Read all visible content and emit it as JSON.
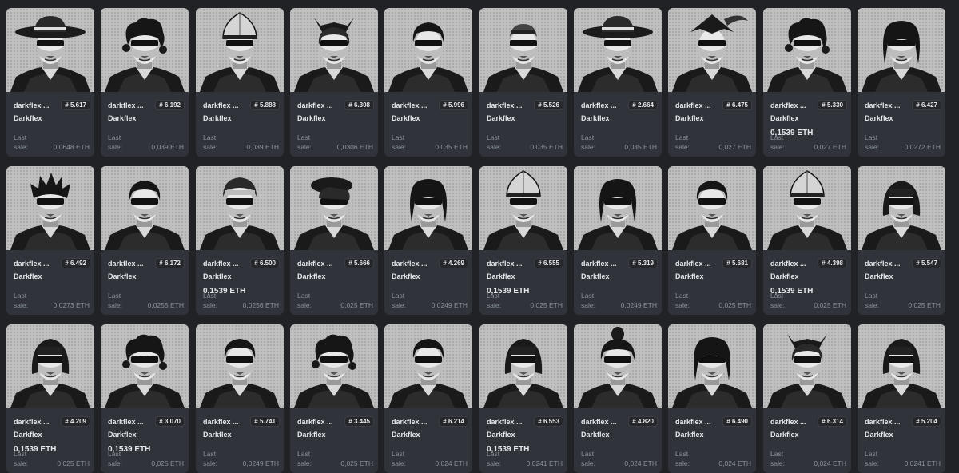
{
  "collection_name": "Darkflex",
  "last_sale_label": "Last sale:",
  "currency": "ETH",
  "rows": [
    [
      {
        "name": "darkflex ...",
        "rank": "# 5.617",
        "price": "",
        "last_sale": "0,0648 ETH",
        "head": "hat"
      },
      {
        "name": "darkflex ...",
        "rank": "# 6.192",
        "price": "",
        "last_sale": "0,039 ETH",
        "head": "curly"
      },
      {
        "name": "darkflex ...",
        "rank": "# 5.888",
        "price": "",
        "last_sale": "0,039 ETH",
        "head": "helmet"
      },
      {
        "name": "darkflex ...",
        "rank": "# 6.308",
        "price": "",
        "last_sale": "0,0306 ETH",
        "head": "horned"
      },
      {
        "name": "darkflex ...",
        "rank": "# 5.996",
        "price": "",
        "last_sale": "0,035 ETH",
        "head": "short"
      },
      {
        "name": "darkflex ...",
        "rank": "# 5.526",
        "price": "",
        "last_sale": "0,035 ETH",
        "head": "bald"
      },
      {
        "name": "darkflex ...",
        "rank": "# 2.664",
        "price": "",
        "last_sale": "0,035 ETH",
        "head": "hat"
      },
      {
        "name": "darkflex ...",
        "rank": "# 6.475",
        "price": "",
        "last_sale": "0,027 ETH",
        "head": "tricorn"
      },
      {
        "name": "darkflex ...",
        "rank": "# 5.330",
        "price": "0,1539 ETH",
        "last_sale": "0,027 ETH",
        "head": "curly"
      },
      {
        "name": "darkflex ...",
        "rank": "# 6.427",
        "price": "",
        "last_sale": "0,0272 ETH",
        "head": "long"
      }
    ],
    [
      {
        "name": "darkflex ...",
        "rank": "# 6.492",
        "price": "",
        "last_sale": "0,0273 ETH",
        "head": "spiky"
      },
      {
        "name": "darkflex ...",
        "rank": "# 6.172",
        "price": "",
        "last_sale": "0,0255 ETH",
        "head": "short"
      },
      {
        "name": "darkflex ...",
        "rank": "# 6.500",
        "price": "0,1539 ETH",
        "last_sale": "0,0256 ETH",
        "head": "cap"
      },
      {
        "name": "darkflex ...",
        "rank": "# 5.666",
        "price": "",
        "last_sale": "0,025 ETH",
        "head": "beret"
      },
      {
        "name": "darkflex ...",
        "rank": "# 4.269",
        "price": "",
        "last_sale": "0,0249 ETH",
        "head": "long"
      },
      {
        "name": "darkflex ...",
        "rank": "# 6.555",
        "price": "0,1539 ETH",
        "last_sale": "0,025 ETH",
        "head": "helmet"
      },
      {
        "name": "darkflex ...",
        "rank": "# 5.319",
        "price": "",
        "last_sale": "0,0249 ETH",
        "head": "long"
      },
      {
        "name": "darkflex ...",
        "rank": "# 5.681",
        "price": "",
        "last_sale": "0,025 ETH",
        "head": "short"
      },
      {
        "name": "darkflex ...",
        "rank": "# 4.398",
        "price": "0,1539 ETH",
        "last_sale": "0,025 ETH",
        "head": "helmet"
      },
      {
        "name": "darkflex ...",
        "rank": "# 5.547",
        "price": "",
        "last_sale": "0,025 ETH",
        "head": "bob"
      }
    ],
    [
      {
        "name": "darkflex ...",
        "rank": "# 4.209",
        "price": "0,1539 ETH",
        "last_sale": "0,025 ETH",
        "head": "bob"
      },
      {
        "name": "darkflex ...",
        "rank": "# 3.070",
        "price": "0,1539 ETH",
        "last_sale": "0,025 ETH",
        "head": "curly"
      },
      {
        "name": "darkflex ...",
        "rank": "# 5.741",
        "price": "",
        "last_sale": "0,0249 ETH",
        "head": "short"
      },
      {
        "name": "darkflex ...",
        "rank": "# 3.445",
        "price": "",
        "last_sale": "0,025 ETH",
        "head": "curly"
      },
      {
        "name": "darkflex ...",
        "rank": "# 6.214",
        "price": "",
        "last_sale": "0,024 ETH",
        "head": "short"
      },
      {
        "name": "darkflex ...",
        "rank": "# 6.553",
        "price": "0,1539 ETH",
        "last_sale": "0,0241 ETH",
        "head": "bob"
      },
      {
        "name": "darkflex ...",
        "rank": "# 4.820",
        "price": "",
        "last_sale": "0,024 ETH",
        "head": "topknot"
      },
      {
        "name": "darkflex ...",
        "rank": "# 6.490",
        "price": "",
        "last_sale": "0,024 ETH",
        "head": "long"
      },
      {
        "name": "darkflex ...",
        "rank": "# 6.314",
        "price": "",
        "last_sale": "0,024 ETH",
        "head": "horned"
      },
      {
        "name": "darkflex ...",
        "rank": "# 5.204",
        "price": "",
        "last_sale": "0,0241 ETH",
        "head": "bob"
      }
    ]
  ],
  "colors": {
    "background": "#202225",
    "card": "#303339",
    "text": "#e5e8eb",
    "muted": "#8a939b"
  }
}
